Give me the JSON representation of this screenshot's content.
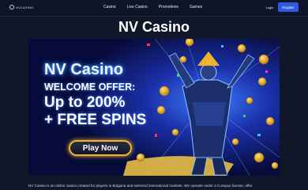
{
  "nav": {
    "logo_text": "NVCASINO",
    "links": [
      "Casino",
      "Live Casino",
      "Promotions",
      "Games"
    ],
    "login_label": "Login",
    "register_label": "Register"
  },
  "page": {
    "title": "NV Casino"
  },
  "banner": {
    "brand": "NV Casino",
    "offer_line": "WELCOME OFFER:",
    "amount_line": "Up to 200%",
    "spins_line": "+ FREE SPINS",
    "cta_label": "Play Now"
  },
  "intro": {
    "text": "NV Casino is an online casino created for players in Bulgaria and selected international markets. We operate under a Curaçao license, offer"
  },
  "colors": {
    "background": "#0f1729",
    "accent_blue": "#2f58e0",
    "gold": "#f0b429"
  }
}
